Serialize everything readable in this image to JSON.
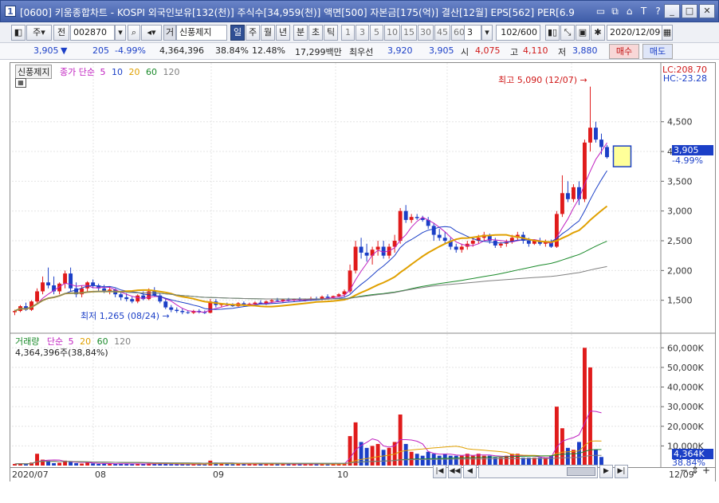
{
  "window": {
    "number": "1",
    "title": "[0600] 키움종합차트 - KOSPI 외국인보유[132(천)] 주식수[34,959(천)] 액면[500] 자본금[175(억)] 결산[12월] EPS[562] PER[6.9",
    "icons": [
      "restore-icon",
      "copy-icon",
      "lock-icon",
      "font-icon",
      "help-icon"
    ],
    "buttons": [
      "_",
      "□",
      "✕"
    ]
  },
  "toolbar": {
    "period_type": "주",
    "mode": "전",
    "code": "002870",
    "stock_name": "신풍제지",
    "name_prefix": "거",
    "period_tabs": [
      "일",
      "주",
      "월",
      "년",
      "분",
      "초",
      "틱"
    ],
    "active_period": "일",
    "minute_options": [
      "1",
      "3",
      "5",
      "10",
      "15",
      "30",
      "45",
      "60"
    ],
    "selected_option": "3",
    "count": "102/600",
    "date": "2020/12/09"
  },
  "quote": {
    "price": "3,905",
    "change": "205",
    "change_pct": "-4.99%",
    "volume": "4,364,396",
    "volume_ratio": "38.84%",
    "turnover": "12.48%",
    "amount": "17,299백만",
    "best_offer_label": "최우선",
    "best_ask": "3,920",
    "best_bid": "3,905",
    "open_label": "시",
    "open": "4,075",
    "high_label": "고",
    "high": "4,110",
    "low_label": "저",
    "low": "3,880",
    "buy_label": "매수",
    "sell_label": "매도"
  },
  "chart": {
    "legend_name": "신풍제지",
    "legend_series": "종가 단순",
    "ma_periods": [
      "5",
      "10",
      "20",
      "60",
      "120"
    ],
    "ma_colors": [
      "#c020c0",
      "#1b3fc7",
      "#e0a000",
      "#1a8a2a",
      "#808080"
    ],
    "lc": "LC:208.70",
    "hc": "HC:-23.28",
    "price_ticks": [
      "4,500",
      "4,000",
      "3,500",
      "3,000",
      "2,500",
      "2,000",
      "1,500"
    ],
    "last_price": "3,905",
    "last_pct": "-4.99%",
    "high_annotation": "최고 5,090 (12/07)",
    "low_annotation": "최저 1,265 (08/24)",
    "volume_legend": "거래량",
    "volume_series": "단순",
    "volume_ma_periods": [
      "5",
      "20",
      "60",
      "120"
    ],
    "volume_ma_colors": [
      "#c020c0",
      "#e0a000",
      "#1a8a2a",
      "#808080"
    ],
    "volume_value": "4,364,396주(38,84%)",
    "volume_ticks": [
      "60,000K",
      "50,000K",
      "40,000K",
      "30,000K",
      "20,000K",
      "10,000K"
    ],
    "last_volume": "4,364K",
    "last_volume_pct": "38.84%",
    "x_labels": [
      "2020/07",
      "08",
      "09",
      "10",
      "11",
      "12",
      "12/09"
    ]
  },
  "chart_data": {
    "type": "candlestick",
    "title": "신풍제지",
    "ylabel": "",
    "ylim": [
      1000,
      5300
    ],
    "x_range": [
      "2020/07",
      "2020/12/09"
    ],
    "highest": {
      "value": 5090,
      "date": "12/07"
    },
    "lowest": {
      "value": 1265,
      "date": "08/24"
    },
    "last": {
      "close": 3905,
      "open": 4075,
      "high": 4110,
      "low": 3880
    },
    "candles": [
      [
        1300,
        1340,
        1250,
        1320
      ],
      [
        1320,
        1420,
        1300,
        1400
      ],
      [
        1400,
        1460,
        1320,
        1340
      ],
      [
        1340,
        1500,
        1320,
        1480
      ],
      [
        1480,
        1700,
        1450,
        1650
      ],
      [
        1650,
        1900,
        1600,
        1800
      ],
      [
        1800,
        2050,
        1700,
        1750
      ],
      [
        1750,
        1900,
        1600,
        1650
      ],
      [
        1650,
        1800,
        1600,
        1780
      ],
      [
        1780,
        2000,
        1700,
        1950
      ],
      [
        1950,
        2050,
        1650,
        1700
      ],
      [
        1700,
        1800,
        1550,
        1600
      ],
      [
        1600,
        1750,
        1550,
        1700
      ],
      [
        1700,
        1820,
        1650,
        1800
      ],
      [
        1800,
        1850,
        1700,
        1750
      ],
      [
        1750,
        1780,
        1650,
        1700
      ],
      [
        1700,
        1760,
        1620,
        1650
      ],
      [
        1650,
        1720,
        1600,
        1680
      ],
      [
        1680,
        1700,
        1550,
        1600
      ],
      [
        1600,
        1650,
        1500,
        1550
      ],
      [
        1550,
        1620,
        1480,
        1520
      ],
      [
        1520,
        1560,
        1450,
        1480
      ],
      [
        1480,
        1600,
        1450,
        1580
      ],
      [
        1580,
        1650,
        1500,
        1520
      ],
      [
        1520,
        1700,
        1500,
        1650
      ],
      [
        1650,
        1720,
        1560,
        1580
      ],
      [
        1580,
        1620,
        1450,
        1480
      ],
      [
        1480,
        1520,
        1350,
        1380
      ],
      [
        1380,
        1420,
        1300,
        1340
      ],
      [
        1340,
        1380,
        1290,
        1320
      ],
      [
        1320,
        1360,
        1265,
        1300
      ],
      [
        1300,
        1330,
        1270,
        1290
      ],
      [
        1290,
        1340,
        1270,
        1320
      ],
      [
        1320,
        1350,
        1280,
        1300
      ],
      [
        1300,
        1330,
        1270,
        1290
      ],
      [
        1290,
        1520,
        1280,
        1480
      ],
      [
        1480,
        1520,
        1380,
        1420
      ],
      [
        1420,
        1450,
        1380,
        1440
      ],
      [
        1440,
        1460,
        1400,
        1420
      ],
      [
        1420,
        1450,
        1390,
        1400
      ],
      [
        1400,
        1470,
        1390,
        1450
      ],
      [
        1450,
        1480,
        1400,
        1420
      ],
      [
        1420,
        1460,
        1400,
        1440
      ],
      [
        1440,
        1480,
        1410,
        1460
      ],
      [
        1460,
        1500,
        1430,
        1440
      ],
      [
        1440,
        1500,
        1420,
        1480
      ],
      [
        1480,
        1520,
        1450,
        1500
      ],
      [
        1500,
        1540,
        1470,
        1490
      ],
      [
        1490,
        1520,
        1460,
        1510
      ],
      [
        1510,
        1540,
        1480,
        1500
      ],
      [
        1500,
        1530,
        1470,
        1520
      ],
      [
        1520,
        1550,
        1490,
        1500
      ],
      [
        1500,
        1530,
        1480,
        1510
      ],
      [
        1510,
        1560,
        1490,
        1530
      ],
      [
        1530,
        1560,
        1500,
        1520
      ],
      [
        1520,
        1580,
        1500,
        1560
      ],
      [
        1560,
        1600,
        1530,
        1540
      ],
      [
        1540,
        1580,
        1520,
        1570
      ],
      [
        1570,
        1620,
        1550,
        1600
      ],
      [
        1600,
        1680,
        1560,
        1650
      ],
      [
        1650,
        2100,
        1620,
        2000
      ],
      [
        2000,
        2500,
        1950,
        2400
      ],
      [
        2400,
        2550,
        2200,
        2300
      ],
      [
        2300,
        2450,
        2150,
        2250
      ],
      [
        2250,
        2400,
        2100,
        2350
      ],
      [
        2350,
        2500,
        2250,
        2400
      ],
      [
        2400,
        2500,
        2200,
        2250
      ],
      [
        2250,
        2450,
        2200,
        2400
      ],
      [
        2400,
        2600,
        2300,
        2500
      ],
      [
        2500,
        3050,
        2450,
        3000
      ],
      [
        3000,
        3100,
        2800,
        2850
      ],
      [
        2850,
        2950,
        2800,
        2900
      ],
      [
        2900,
        2950,
        2850,
        2880
      ],
      [
        2880,
        2920,
        2820,
        2850
      ],
      [
        2850,
        2900,
        2700,
        2750
      ],
      [
        2750,
        2800,
        2500,
        2600
      ],
      [
        2600,
        2700,
        2500,
        2550
      ],
      [
        2550,
        2650,
        2450,
        2500
      ],
      [
        2500,
        2550,
        2350,
        2400
      ],
      [
        2400,
        2450,
        2300,
        2350
      ],
      [
        2350,
        2450,
        2300,
        2400
      ],
      [
        2400,
        2500,
        2350,
        2450
      ],
      [
        2450,
        2550,
        2400,
        2500
      ],
      [
        2500,
        2600,
        2450,
        2550
      ],
      [
        2550,
        2650,
        2500,
        2600
      ],
      [
        2600,
        2620,
        2450,
        2500
      ],
      [
        2500,
        2550,
        2380,
        2420
      ],
      [
        2420,
        2480,
        2380,
        2450
      ],
      [
        2450,
        2520,
        2400,
        2480
      ],
      [
        2480,
        2600,
        2450,
        2550
      ],
      [
        2550,
        2650,
        2500,
        2600
      ],
      [
        2600,
        2650,
        2450,
        2500
      ],
      [
        2500,
        2550,
        2400,
        2450
      ],
      [
        2450,
        2520,
        2430,
        2500
      ],
      [
        2500,
        2550,
        2420,
        2450
      ],
      [
        2450,
        2520,
        2400,
        2480
      ],
      [
        2480,
        2520,
        2380,
        2400
      ],
      [
        2400,
        3000,
        2380,
        2950
      ],
      [
        2950,
        3600,
        2900,
        3300
      ],
      [
        3300,
        3500,
        3150,
        3200
      ],
      [
        3200,
        3450,
        3150,
        3400
      ],
      [
        3400,
        3500,
        3100,
        3200
      ],
      [
        3200,
        4200,
        3150,
        4150
      ],
      [
        4150,
        5090,
        4000,
        4400
      ],
      [
        4400,
        4500,
        4150,
        4200
      ],
      [
        4200,
        4300,
        3950,
        4075
      ],
      [
        4075,
        4110,
        3880,
        3905
      ]
    ],
    "volume": {
      "ylim": [
        0,
        65000
      ],
      "unit": "K shares",
      "values": [
        800,
        1200,
        600,
        1500,
        6000,
        3000,
        2500,
        1200,
        1400,
        2500,
        2000,
        1200,
        1000,
        1500,
        1100,
        800,
        900,
        800,
        1000,
        900,
        800,
        700,
        900,
        700,
        1100,
        900,
        800,
        900,
        700,
        600,
        700,
        600,
        600,
        700,
        600,
        2500,
        1500,
        900,
        800,
        700,
        900,
        800,
        700,
        900,
        700,
        800,
        900,
        700,
        800,
        700,
        800,
        700,
        800,
        900,
        700,
        800,
        700,
        800,
        900,
        1200,
        15000,
        22000,
        12000,
        9000,
        10000,
        11000,
        8000,
        9000,
        12000,
        26000,
        11000,
        7000,
        6000,
        5000,
        7000,
        6000,
        5000,
        6000,
        5000,
        5000,
        5000,
        6000,
        5000,
        6000,
        5000,
        5000,
        4000,
        4000,
        5000,
        6000,
        6000,
        4000,
        4000,
        4000,
        4000,
        4000,
        5000,
        30000,
        19000,
        9000,
        8000,
        12000,
        60000,
        50000,
        8000,
        4364
      ]
    }
  }
}
